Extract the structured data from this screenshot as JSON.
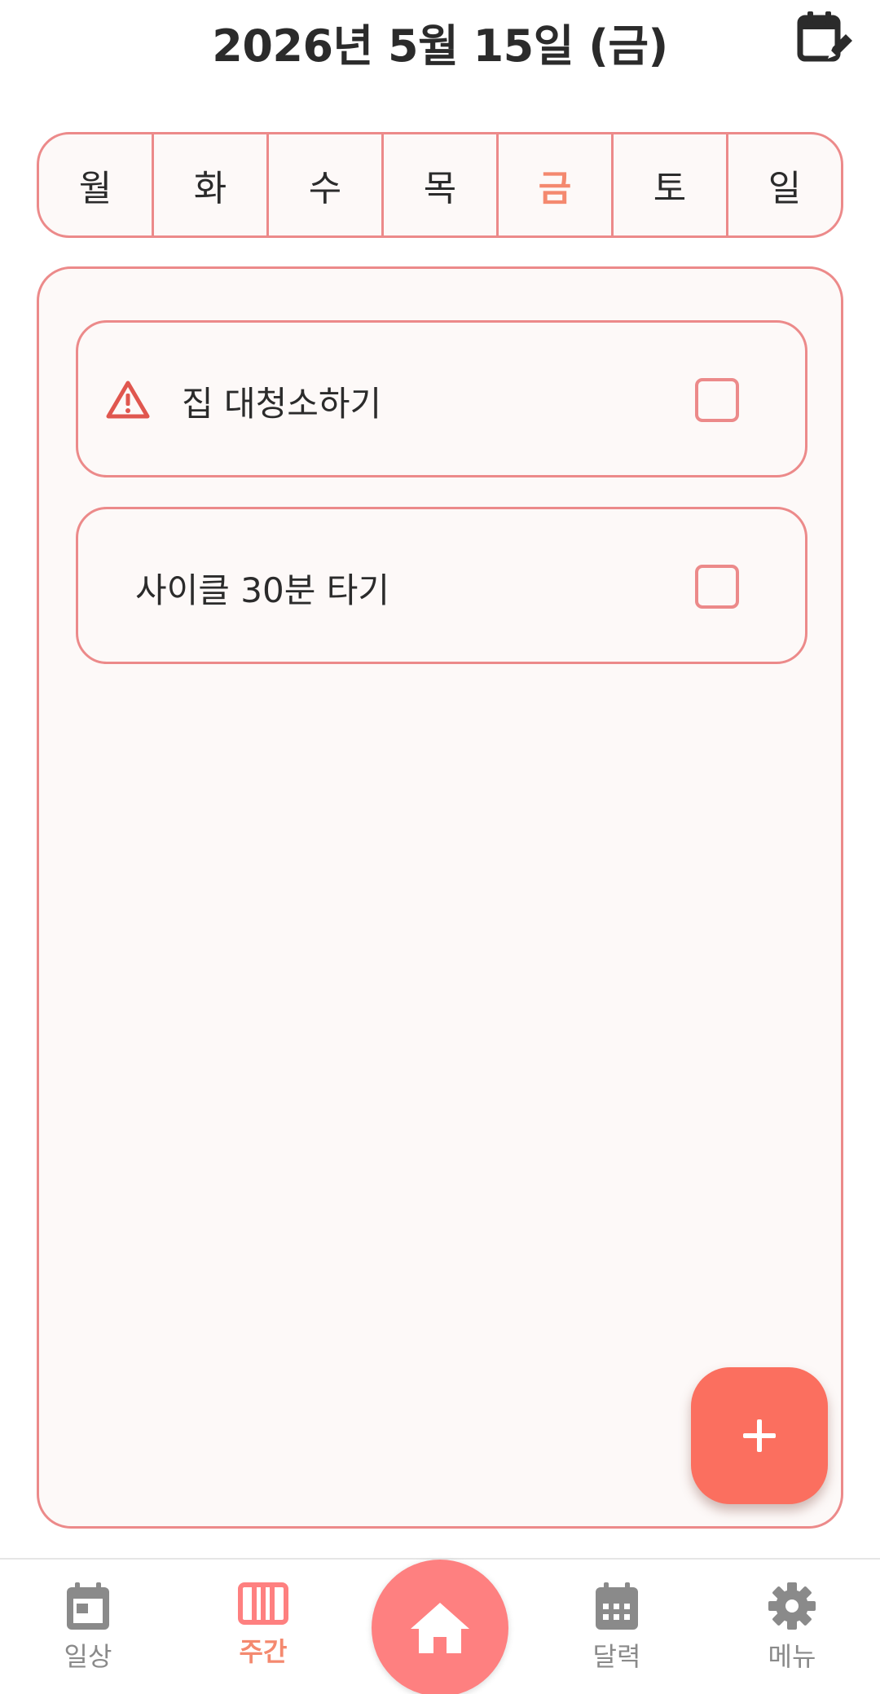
{
  "header": {
    "title": "2026년 5월 15일 (금)"
  },
  "weekdays": {
    "mon": "월",
    "tue": "화",
    "wed": "수",
    "thu": "목",
    "fri": "금",
    "sat": "토",
    "sun": "일",
    "selected": "금"
  },
  "tasks": [
    {
      "label": "집 대청소하기",
      "icon": "warning-icon",
      "checked": false
    },
    {
      "label": "사이클 30분 타기",
      "icon": null,
      "checked": false
    }
  ],
  "fab": {
    "icon": "plus-icon"
  },
  "nav": {
    "daily": {
      "label": "일상",
      "icon": "calendar-day-icon"
    },
    "weekly": {
      "label": "주간",
      "icon": "week-columns-icon"
    },
    "home": {
      "icon": "home-icon"
    },
    "calendar": {
      "label": "달력",
      "icon": "calendar-grid-icon"
    },
    "menu": {
      "label": "메뉴",
      "icon": "gear-icon"
    }
  },
  "colors": {
    "accent": "#f4896f",
    "border": "#ec8a8a",
    "fab": "#fb6f5f",
    "home": "#fe8080",
    "warning": "#e0574f"
  }
}
